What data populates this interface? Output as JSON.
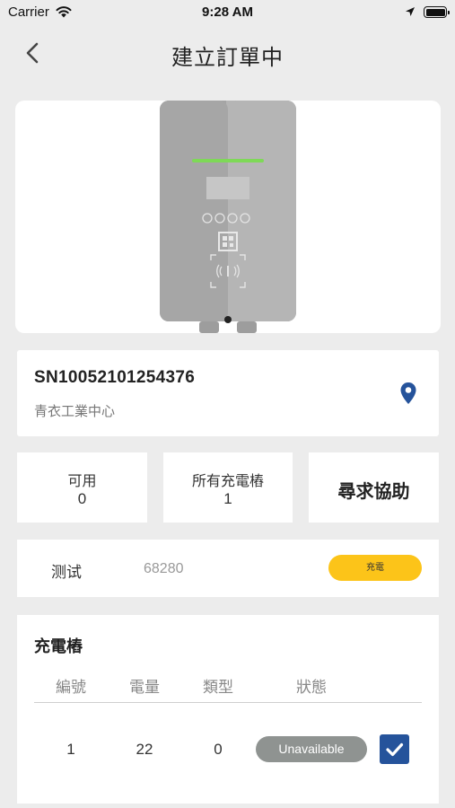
{
  "status_bar": {
    "carrier": "Carrier",
    "time": "9:28 AM"
  },
  "nav": {
    "title": "建立訂單中",
    "back_icon": "chevron-left-icon"
  },
  "charger_card": {
    "image": "ev-charger-image"
  },
  "info": {
    "serial": "SN10052101254376",
    "site": "青衣工業中心",
    "location_icon": "map-pin-icon"
  },
  "stats": {
    "available": {
      "label": "可用",
      "value": "0"
    },
    "total": {
      "label": "所有充電樁",
      "value": "1"
    },
    "help": {
      "label": "尋求協助"
    }
  },
  "test_row": {
    "name": "测试",
    "number": "68280",
    "button_label": "充電"
  },
  "piles": {
    "title": "充電樁",
    "columns": [
      "編號",
      "電量",
      "類型",
      "狀態"
    ],
    "rows": [
      {
        "number": "1",
        "power": "22",
        "type": "0",
        "status": "Unavailable",
        "checked": true
      }
    ]
  },
  "colors": {
    "accent_blue": "#25539b",
    "charge_button": "#fcc419",
    "status_gray": "#8f9391",
    "led_green": "#7ed957"
  }
}
